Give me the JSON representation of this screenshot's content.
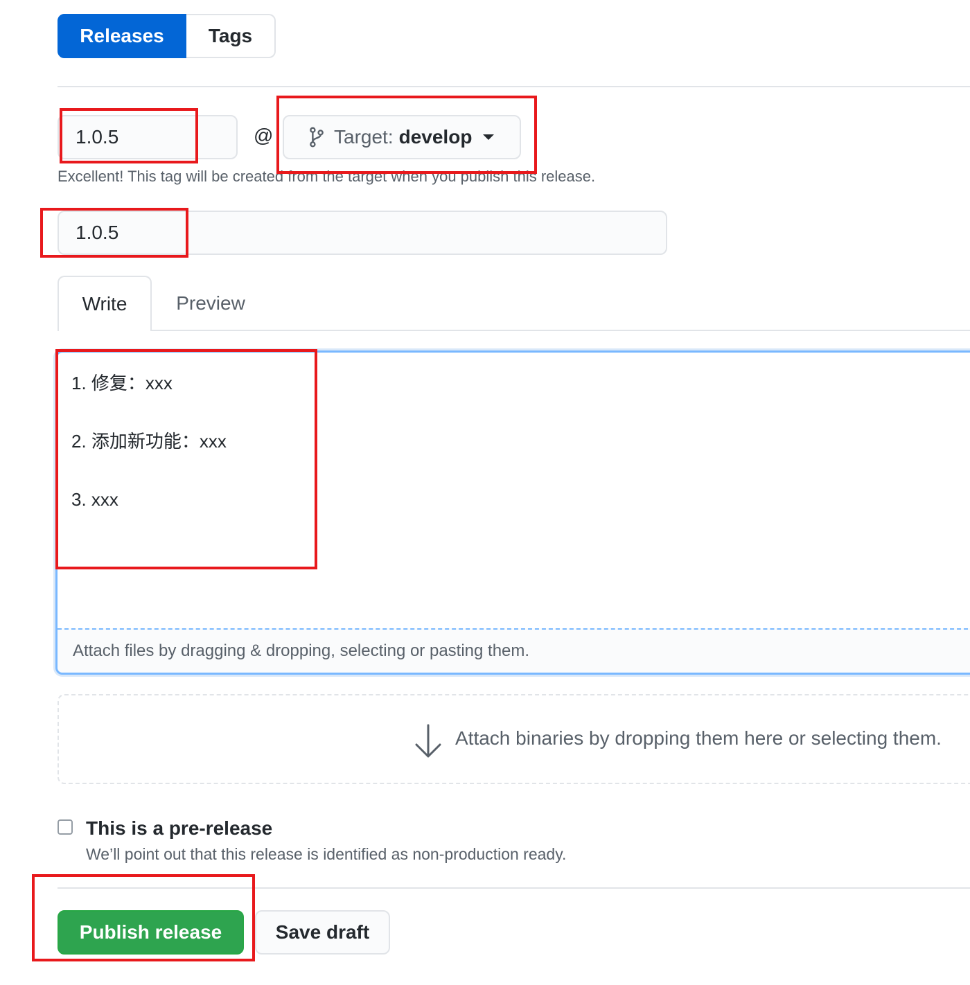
{
  "subnav": {
    "releases_label": "Releases",
    "tags_label": "Tags"
  },
  "tag_form": {
    "tag_value": "1.0.5",
    "at_symbol": "@",
    "target_label": "Target:",
    "target_branch": "develop",
    "hint": "Excellent! This tag will be created from the target when you publish this release."
  },
  "release_title": {
    "value": "1.0.5"
  },
  "editor": {
    "tabs": [
      {
        "label": "Write",
        "selected": true
      },
      {
        "label": "Preview",
        "selected": false
      }
    ],
    "lines": [
      "1. 修复：xxx",
      "2. 添加新功能：xxx",
      "3. xxx"
    ],
    "attach_hint": "Attach files by dragging & dropping, selecting or pasting them."
  },
  "binaries": {
    "hint": "Attach binaries by dropping them here or selecting them."
  },
  "prerelease": {
    "checked": false,
    "title": "This is a pre-release",
    "note": "We’ll point out that this release is identified as non-production ready."
  },
  "actions": {
    "publish_label": "Publish release",
    "draft_label": "Save draft"
  },
  "colors": {
    "primary_blue": "#0366d6",
    "publish_green": "#2ea44f",
    "annotation_red": "#e8191c",
    "focus_blue": "#79b8ff"
  }
}
